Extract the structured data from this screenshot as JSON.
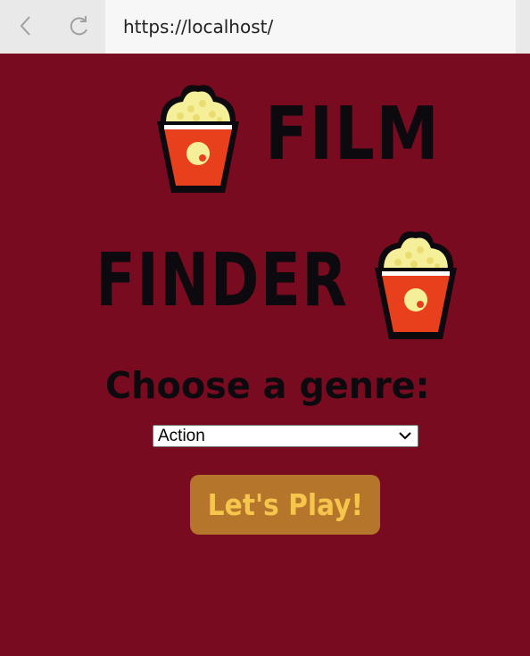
{
  "browser": {
    "url": "https://localhost/",
    "back_icon": "chevron-left-icon",
    "reload_icon": "reload-icon"
  },
  "header": {
    "title_line1": "FILM",
    "title_line2": "FINDER",
    "logo_icon": "popcorn-icon"
  },
  "form": {
    "prompt": "Choose a genre:",
    "genre_selected": "Action",
    "play_label": "Let's Play!"
  },
  "colors": {
    "background": "#790b20",
    "title": "#0c0a0e",
    "button_bg": "#b5752b",
    "button_text": "#f6c64c",
    "popcorn_bucket": "#e8401c",
    "popcorn_kernel": "#f5ef9a"
  }
}
